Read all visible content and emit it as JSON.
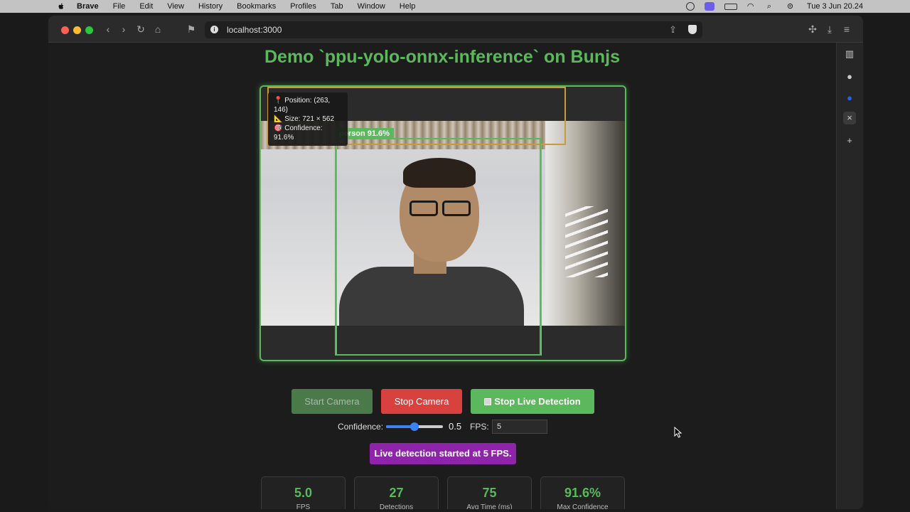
{
  "menubar": {
    "app": "Brave",
    "items": [
      "File",
      "Edit",
      "View",
      "History",
      "Bookmarks",
      "Profiles",
      "Tab",
      "Window",
      "Help"
    ],
    "clock": "Tue 3 Jun 20.24"
  },
  "browser": {
    "url": "localhost:3000"
  },
  "page": {
    "title": "Demo `ppu-yolo-onnx-inference` on Bunjs",
    "detection": {
      "label": "person 91.6%",
      "tooltip": {
        "position": "📍 Position: (263, 146)",
        "size": "📐 Size: 721 × 562",
        "confidence": "🎯 Confidence: 91.6%"
      }
    },
    "buttons": {
      "start_camera": "Start Camera",
      "stop_camera": "Stop Camera",
      "stop_live": "Stop Live Detection"
    },
    "settings": {
      "confidence_label": "Confidence:",
      "confidence_value": "0.5",
      "confidence_fraction": 0.5,
      "fps_label": "FPS:",
      "fps_value": "5"
    },
    "status": "Live detection started at 5 FPS.",
    "stats": [
      {
        "value": "5.0",
        "label": "FPS"
      },
      {
        "value": "27",
        "label": "Detections"
      },
      {
        "value": "75",
        "label": "Avg Time (ms)"
      },
      {
        "value": "91.6%",
        "label": "Max Confidence"
      }
    ]
  },
  "colors": {
    "accent": "#5cb85c",
    "danger": "#d9413f",
    "status": "#8e24aa",
    "slider": "#3b82f6"
  }
}
